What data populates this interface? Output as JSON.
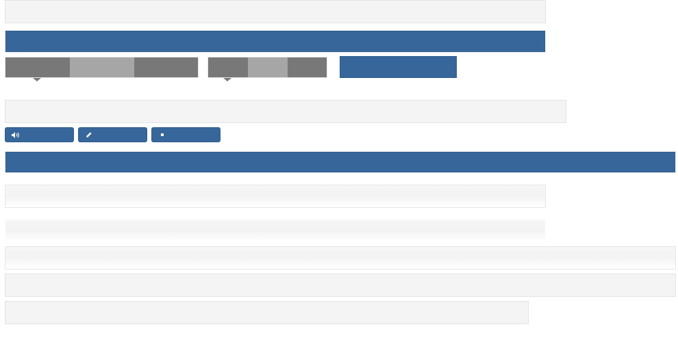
{
  "top_field": {
    "value": ""
  },
  "header_bar": {
    "title": ""
  },
  "tabs_group_a": {
    "items": [
      "",
      "",
      ""
    ]
  },
  "tabs_group_b": {
    "items": [
      "",
      "",
      ""
    ]
  },
  "primary_button": {
    "label": ""
  },
  "second_field": {
    "value": ""
  },
  "actions": {
    "audio": {
      "label": "",
      "icon": "speaker-icon"
    },
    "edit": {
      "label": "",
      "icon": "pencil-icon"
    },
    "stop": {
      "label": "",
      "icon": "square-icon"
    }
  },
  "section_bar": {
    "title": ""
  },
  "rows": [
    {
      "value": ""
    },
    {
      "value": ""
    },
    {
      "value": ""
    },
    {
      "value": ""
    },
    {
      "value": ""
    }
  ],
  "colors": {
    "accent": "#37679a",
    "tab_dark": "#787878",
    "tab_light": "#a6a6a6",
    "field_bg": "#f4f4f4"
  }
}
